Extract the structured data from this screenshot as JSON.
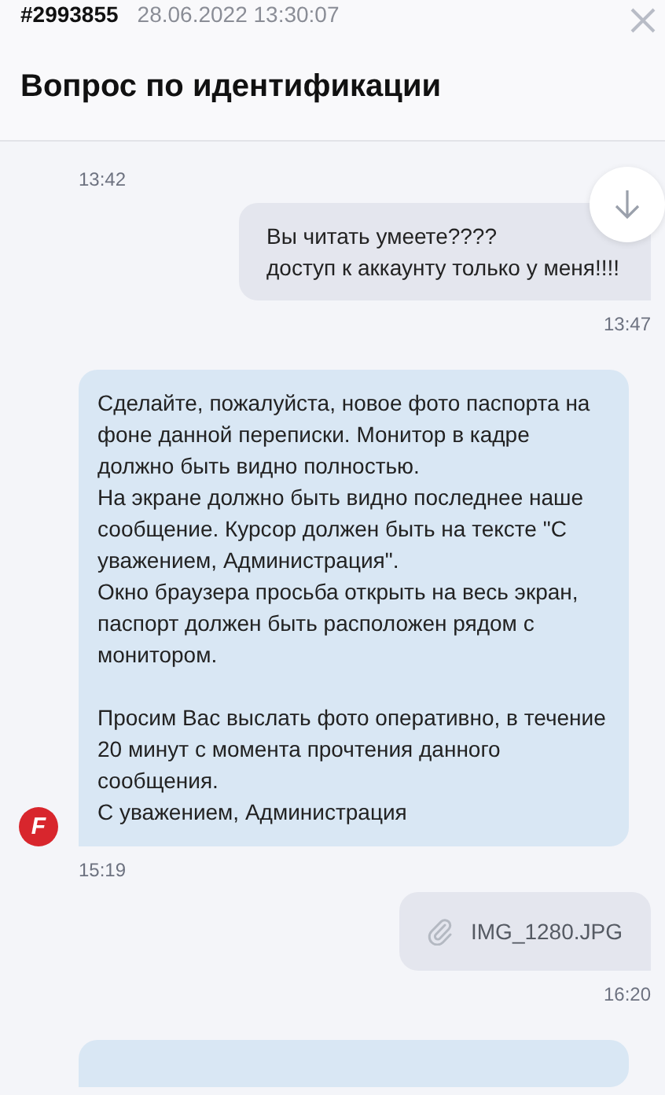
{
  "ticket": {
    "number": "#2993855",
    "datetime": "28.06.2022 13:30:07"
  },
  "title": "Вопрос по идентификации",
  "messages": [
    {
      "kind": "incoming_time",
      "time": "13:42"
    },
    {
      "kind": "outgoing",
      "text": "Вы читать умеете????\nдоступ к аккаунту только у меня!!!!",
      "time": "13:47"
    },
    {
      "kind": "incoming",
      "avatar": "F",
      "text": " Сделайте, пожалуйста, новое фото паспорта на фоне данной переписки. Монитор в кадре должно быть видно полностью.\n На экране должно быть видно последнее наше сообщение. Курсор должен быть на тексте \"С уважением, Администрация\".\n Окно браузера просьба открыть на весь экран, паспорт должен быть расположен рядом с монитором.\n\n Просим Вас выслать фото оперативно, в течение 20 минут с момента прочтения данного сообщения.\nС уважением, Администрация",
      "time": "15:19"
    },
    {
      "kind": "outgoing_file",
      "file_name": "IMG_1280.JPG",
      "time": "16:20"
    },
    {
      "kind": "incoming_cut"
    }
  ]
}
